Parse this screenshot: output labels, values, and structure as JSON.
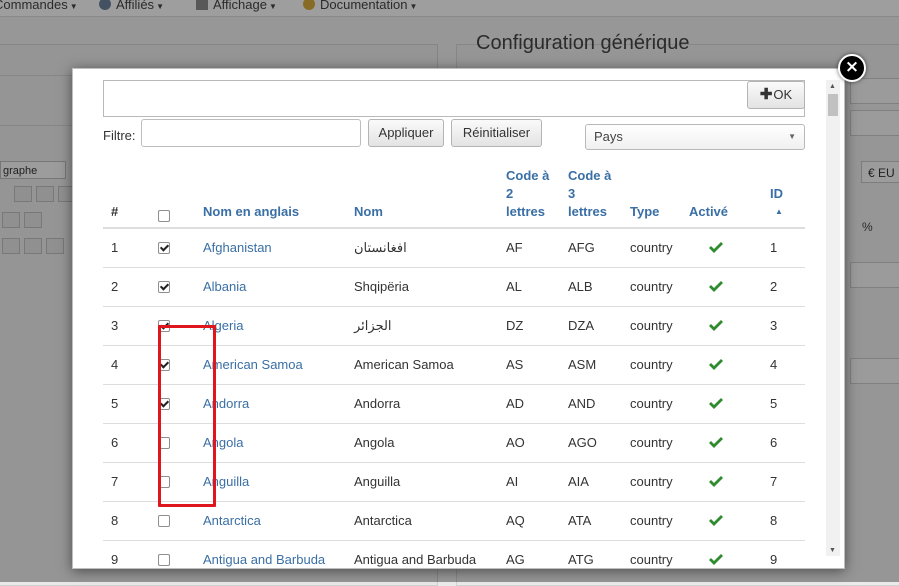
{
  "background": {
    "menu": [
      {
        "label": "Commandes",
        "icon": "none"
      },
      {
        "label": "Affiliés",
        "icon": "users-icon"
      },
      {
        "label": "Affichage",
        "icon": "display-icon"
      },
      {
        "label": "Documentation",
        "icon": "support-icon"
      }
    ],
    "section_title": "Configuration générique",
    "paragraph_select": "graphe",
    "currency": "€ EU",
    "percent": "%"
  },
  "modal": {
    "ok_label": "OK",
    "filter_label": "Filtre:",
    "filter_value": "",
    "apply_label": "Appliquer",
    "reset_label": "Réinitialiser",
    "country_select": "Pays",
    "close_symbol": "×",
    "columns": {
      "num": "#",
      "english": "Nom en anglais",
      "name": "Nom",
      "code2": [
        "Code à",
        "2",
        "lettres"
      ],
      "code3": [
        "Code à",
        "3",
        "lettres"
      ],
      "type": "Type",
      "active": "Activé",
      "id": "ID"
    },
    "rows": [
      {
        "num": "1",
        "checked": true,
        "english": "Afghanistan",
        "name": "افغانستان",
        "code2": "AF",
        "code3": "AFG",
        "type": "country",
        "id": "1"
      },
      {
        "num": "2",
        "checked": true,
        "english": "Albania",
        "name": "Shqipëria",
        "code2": "AL",
        "code3": "ALB",
        "type": "country",
        "id": "2"
      },
      {
        "num": "3",
        "checked": true,
        "english": "Algeria",
        "name": "الجزائر",
        "code2": "DZ",
        "code3": "DZA",
        "type": "country",
        "id": "3"
      },
      {
        "num": "4",
        "checked": true,
        "english": "American Samoa",
        "name": "American Samoa",
        "code2": "AS",
        "code3": "ASM",
        "type": "country",
        "id": "4"
      },
      {
        "num": "5",
        "checked": true,
        "english": "Andorra",
        "name": "Andorra",
        "code2": "AD",
        "code3": "AND",
        "type": "country",
        "id": "5"
      },
      {
        "num": "6",
        "checked": false,
        "english": "Angola",
        "name": "Angola",
        "code2": "AO",
        "code3": "AGO",
        "type": "country",
        "id": "6"
      },
      {
        "num": "7",
        "checked": false,
        "english": "Anguilla",
        "name": "Anguilla",
        "code2": "AI",
        "code3": "AIA",
        "type": "country",
        "id": "7"
      },
      {
        "num": "8",
        "checked": false,
        "english": "Antarctica",
        "name": "Antarctica",
        "code2": "AQ",
        "code3": "ATA",
        "type": "country",
        "id": "8"
      },
      {
        "num": "9",
        "checked": false,
        "english": "Antigua and Barbuda",
        "name": "Antigua and Barbuda",
        "code2": "AG",
        "code3": "ATG",
        "type": "country",
        "id": "9"
      }
    ],
    "colors": {
      "link": "#3a6fa5",
      "tick": "#2e8b2e",
      "highlight": "#e0161e"
    }
  }
}
